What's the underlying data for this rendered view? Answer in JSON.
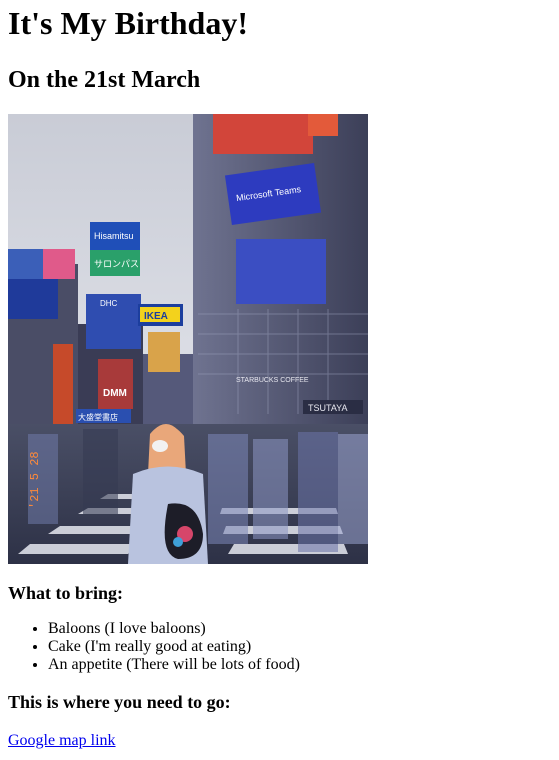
{
  "heading": "It's My Birthday!",
  "date": "On the 21st March",
  "photo": {
    "sign_hisamitsu": "Hisamitsu",
    "sign_salonpas": "サロンパス",
    "sign_ikea": "IKEA",
    "sign_teams": "Microsoft Teams",
    "sign_starbucks": "STARBUCKS COFFEE",
    "sign_tsutaya": "TSUTAYA",
    "sign_dmm": "DMM",
    "sign_dhc": "DHC",
    "sign_tokyu": "大盛堂書店",
    "date_stamp": "'21 5 28"
  },
  "bring": {
    "title": "What to bring:",
    "items": [
      "Baloons (I love baloons)",
      "Cake (I'm really good at eating)",
      "An appetite (There will be lots of food)"
    ]
  },
  "go": {
    "title": "This is where you need to go:",
    "link_text": "Google map link"
  }
}
